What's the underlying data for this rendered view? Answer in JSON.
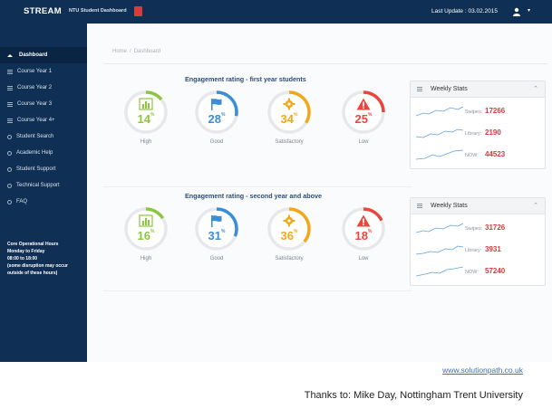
{
  "topbar": {
    "brand": "STREAM",
    "brand_sub": "NTU Student Dashboard",
    "last_update": "Last Update : 03.02.2015"
  },
  "sidebar": {
    "items": [
      {
        "label": "Dashboard",
        "icon": "home-icon",
        "active": true
      },
      {
        "label": "Course Year 1",
        "icon": "list-icon"
      },
      {
        "label": "Course Year 2",
        "icon": "list-icon"
      },
      {
        "label": "Course Year 3",
        "icon": "list-icon"
      },
      {
        "label": "Course Year 4+",
        "icon": "list-icon"
      },
      {
        "label": "Student Search",
        "icon": "search-icon"
      },
      {
        "label": "Academic Help",
        "icon": "info-icon"
      },
      {
        "label": "Student Support",
        "icon": "info-icon"
      },
      {
        "label": "Technical Support",
        "icon": "info-icon"
      },
      {
        "label": "FAQ",
        "icon": "info-icon"
      }
    ],
    "hours": [
      "Core Operational Hours",
      "Monday to Friday",
      "08:00 to 18:00",
      "(some disruption may occur",
      "outside of these hours)"
    ]
  },
  "breadcrumb": {
    "home": "Home",
    "sep": "/",
    "current": "Dashboard"
  },
  "sections": [
    {
      "title": "Engagement rating - first year students",
      "gauges": [
        {
          "value": "14",
          "pct": 0.14,
          "label": "High",
          "color": "#8cc63f",
          "icon": "chart-icon"
        },
        {
          "value": "28",
          "pct": 0.28,
          "label": "Good",
          "color": "#3a8ed6",
          "icon": "flag-icon"
        },
        {
          "value": "34",
          "pct": 0.34,
          "label": "Satisfactory",
          "color": "#f2a818",
          "icon": "cog-icon"
        },
        {
          "value": "25",
          "pct": 0.25,
          "label": "Low",
          "color": "#e8473f",
          "icon": "warning-icon"
        }
      ],
      "stats": {
        "title": "Weekly Stats",
        "rows": [
          {
            "label": "Swipes:",
            "value": "17266"
          },
          {
            "label": "Library:",
            "value": "2190"
          },
          {
            "label": "NOW:",
            "value": "44523"
          }
        ]
      }
    },
    {
      "title": "Engagement rating - second year and above",
      "gauges": [
        {
          "value": "16",
          "pct": 0.16,
          "label": "High",
          "color": "#8cc63f",
          "icon": "chart-icon"
        },
        {
          "value": "31",
          "pct": 0.31,
          "label": "Good",
          "color": "#3a8ed6",
          "icon": "flag-icon"
        },
        {
          "value": "36",
          "pct": 0.36,
          "label": "Satisfactory",
          "color": "#f2a818",
          "icon": "cog-icon"
        },
        {
          "value": "18",
          "pct": 0.18,
          "label": "Low",
          "color": "#e8473f",
          "icon": "warning-icon"
        }
      ],
      "stats": {
        "title": "Weekly Stats",
        "rows": [
          {
            "label": "Swipes:",
            "value": "31726"
          },
          {
            "label": "Library:",
            "value": "3931"
          },
          {
            "label": "NOW:",
            "value": "57240"
          }
        ]
      }
    }
  ],
  "footer": {
    "url": "www.solutionpath.co.uk",
    "thanks": "Thanks to: Mike Day, Nottingham Trent University"
  }
}
